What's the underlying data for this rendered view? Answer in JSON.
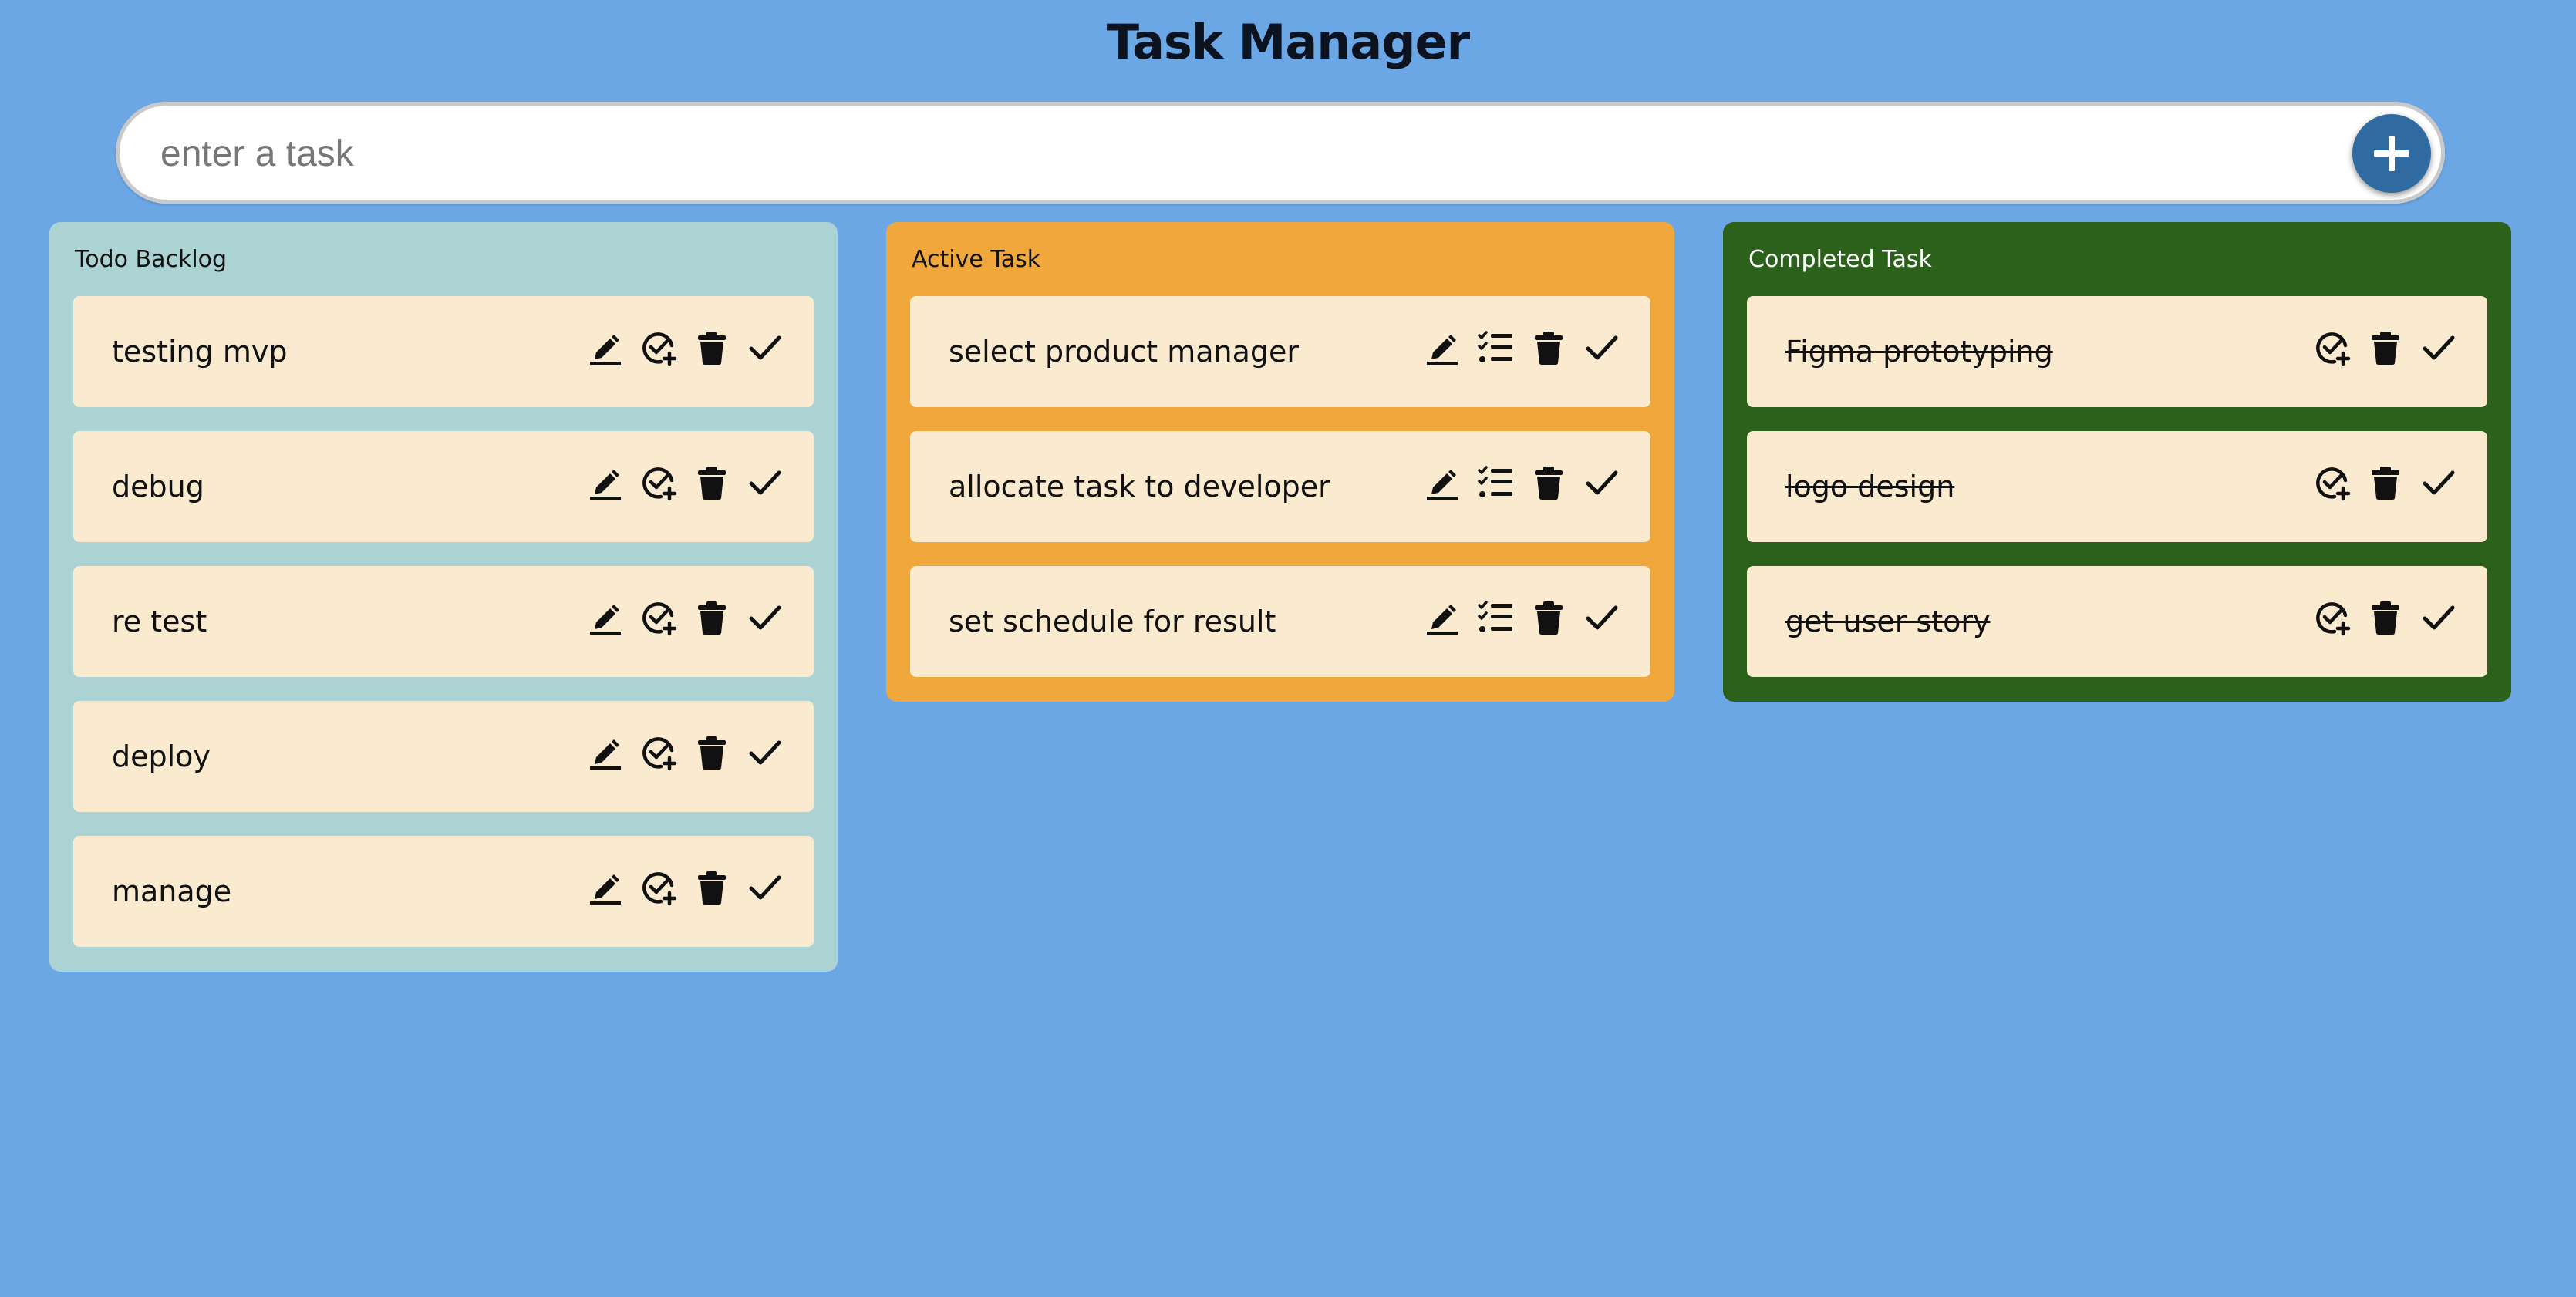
{
  "app": {
    "title": "Task Manager"
  },
  "input": {
    "placeholder": "enter a task",
    "add_icon": "plus-icon"
  },
  "colors": {
    "background": "#6ca7e5",
    "todo_column": "#abd3d4",
    "active_column": "#f0a83c",
    "completed_column": "#2b611a",
    "card": "#faebd0",
    "add_button": "#2f6aa0"
  },
  "columns": [
    {
      "title": "Todo Backlog",
      "tasks": [
        {
          "text": "testing mvp"
        },
        {
          "text": "debug"
        },
        {
          "text": "re test"
        },
        {
          "text": "deploy"
        },
        {
          "text": "manage"
        }
      ],
      "actions": [
        "edit-icon",
        "check-circle-plus-icon",
        "trash-icon",
        "check-icon"
      ]
    },
    {
      "title": "Active Task",
      "tasks": [
        {
          "text": "select product manager"
        },
        {
          "text": "allocate task to developer"
        },
        {
          "text": "set schedule for result"
        }
      ],
      "actions": [
        "edit-icon",
        "checklist-icon",
        "trash-icon",
        "check-icon"
      ]
    },
    {
      "title": "Completed Task",
      "tasks": [
        {
          "text": "Figma prototyping"
        },
        {
          "text": "logo design"
        },
        {
          "text": "get user story"
        }
      ],
      "actions": [
        "check-circle-plus-icon",
        "trash-icon",
        "check-icon"
      ]
    }
  ]
}
